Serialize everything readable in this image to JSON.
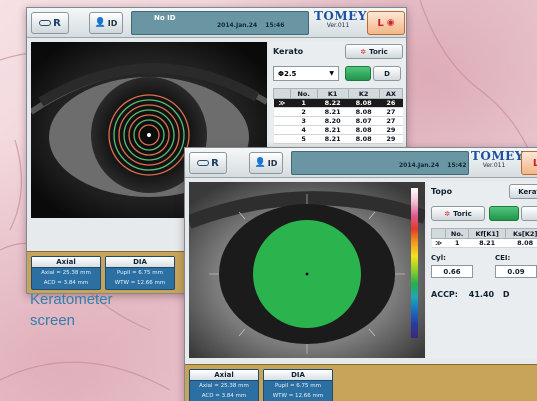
{
  "caption": [
    "Keratometer",
    "screen"
  ],
  "colors": {
    "accent_green": "#2bb34e",
    "caption_blue": "#2f7fb0",
    "brand_blue": "#1f4fa0"
  },
  "screen1": {
    "logo_label": "R",
    "id_label": "ID",
    "patient_id_label": "No ID",
    "date": "2014.Jan.24",
    "time": "15:46",
    "brand": "TOMEY",
    "version": "Ver.011",
    "eye_side": "L",
    "kerato": {
      "title": "Kerato",
      "toric_label": "Toric",
      "mire_select": "Φ2.5",
      "toggle_d_label": "D",
      "columns": [
        "No.",
        "K1",
        "K2",
        "AX"
      ],
      "rows": [
        {
          "mark": "≫",
          "no": "1",
          "k1": "8.22",
          "k2": "8.08",
          "ax": "26"
        },
        {
          "mark": "",
          "no": "2",
          "k1": "8.21",
          "k2": "8.08",
          "ax": "27"
        },
        {
          "mark": "",
          "no": "3",
          "k1": "8.20",
          "k2": "8.07",
          "ax": "27"
        },
        {
          "mark": "",
          "no": "4",
          "k1": "8.21",
          "k2": "8.08",
          "ax": "29"
        },
        {
          "mark": "",
          "no": "5",
          "k1": "8.21",
          "k2": "8.08",
          "ax": "29"
        }
      ]
    },
    "axial": {
      "title": "Axial",
      "line1": "Axial = 25.38 mm",
      "line2": "ACD = 3.84 mm"
    },
    "dia": {
      "title": "DIA",
      "line1": "Pupil = 6.75 mm",
      "line2": "WTW = 12.66 mm"
    }
  },
  "screen2": {
    "logo_label": "R",
    "id_label": "ID",
    "date": "2014.Jan.24",
    "time": "15:42",
    "brand": "TOMEY",
    "version": "Ver.011",
    "eye_side": "L",
    "topo": {
      "title": "Topo",
      "kerato_btn": "Kerat",
      "toric_label": "Toric",
      "columns": [
        "No.",
        "Kf[K1]",
        "Ks[K2]"
      ],
      "rows": [
        {
          "mark": "≫",
          "no": "1",
          "kf": "8.21",
          "ks": "8.08"
        }
      ],
      "cyl_label": "Cyl:",
      "cyl_value": "0.66",
      "cel_label": "CEI:",
      "cel_value": "0.09",
      "accp_label": "ACCP:",
      "accp_value": "41.40",
      "accp_unit": "D"
    },
    "axial": {
      "title": "Axial",
      "line1": "Axial = 25.38 mm",
      "line2": "ACD = 3.84 mm"
    },
    "dia": {
      "title": "DIA",
      "line1": "Pupil = 6.75 mm",
      "line2": "WTW = 12.66 mm"
    }
  }
}
